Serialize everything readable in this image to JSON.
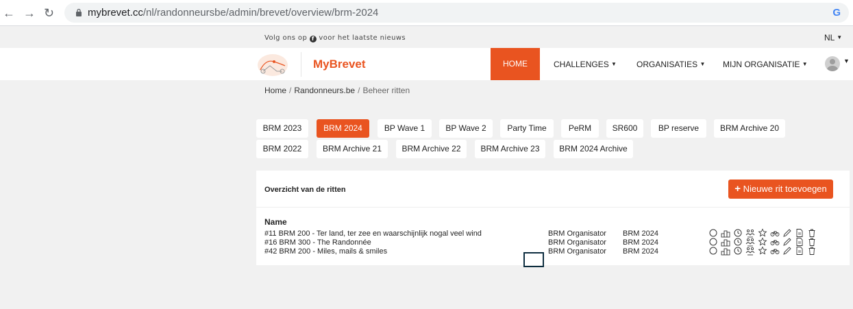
{
  "browser": {
    "back_icon": "back-arrow-icon",
    "forward_icon": "forward-arrow-icon",
    "reload_icon": "reload-icon",
    "url_host": "mybrevet.cc",
    "url_path": "/nl/randonneursbe/admin/brevet/overview/brm-2024",
    "g_label": "G"
  },
  "topstrip": {
    "follow_prefix": "Volg ons op",
    "follow_suffix": "voor het laatste nieuws",
    "fb_glyph": "f",
    "language": "NL"
  },
  "navbar": {
    "brand": "MyBrevet",
    "items": {
      "home": "HOME",
      "challenges": "CHALLENGES",
      "organisaties": "ORGANISATIES",
      "mijn_organisatie": "MIJN ORGANISATIE"
    }
  },
  "breadcrumb": {
    "home": "Home",
    "org": "Randonneurs.be",
    "current": "Beheer ritten",
    "separator": "/"
  },
  "tabs": [
    "BRM 2023",
    "BRM 2024",
    "BP Wave 1",
    "BP Wave 2",
    "Party Time",
    "PeRM",
    "SR600",
    "BP reserve",
    "BRM Archive 20",
    "BRM 2022",
    "BRM Archive 21",
    "BRM Archive 22",
    "BRM Archive 23",
    "BRM 2024 Archive"
  ],
  "active_tab": "BRM 2024",
  "overview": {
    "title": "Overzicht van de ritten",
    "add_plus": "+",
    "add_label": "Nieuwe rit toevoegen",
    "column_name": "Name",
    "rows": [
      {
        "name": "#11 BRM 200 - Ter land, ter zee en waarschijnlijk nogal veel wind",
        "organizer": "BRM Organisator",
        "category": "BRM 2024"
      },
      {
        "name": "#16 BRM 300 - The Randonnée",
        "organizer": "BRM Organisator",
        "category": "BRM 2024"
      },
      {
        "name": "#42 BRM 200 - Miles, mails & smiles",
        "organizer": "BRM Organisator",
        "category": "BRM 2024"
      }
    ],
    "action_icons": [
      "circle-icon",
      "podium-icon",
      "clock-icon",
      "group-icon",
      "star-icon",
      "bicycle-icon",
      "pencil-icon",
      "document-icon",
      "trash-icon"
    ]
  },
  "colors": {
    "accent": "#e95420",
    "highlight_border": "#0d2d3f"
  }
}
